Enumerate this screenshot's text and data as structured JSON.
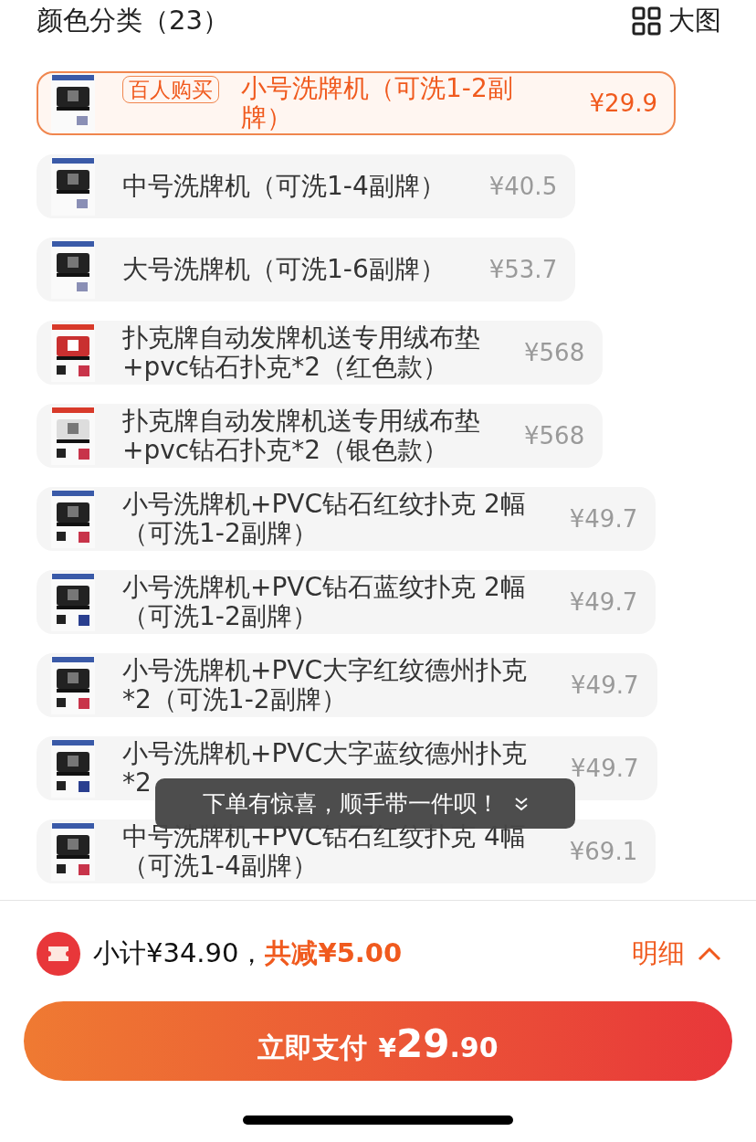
{
  "header": {
    "title": "颜色分类（23）",
    "view_toggle": "大图"
  },
  "options": [
    {
      "lines": [
        "小号洗牌机（可洗1-2副",
        "牌）"
      ],
      "price": "¥29.9",
      "selected": true,
      "badge": "百人购买"
    },
    {
      "lines": [
        "中号洗牌机（可洗1-4副牌）"
      ],
      "price": "¥40.5",
      "selected": false
    },
    {
      "lines": [
        "大号洗牌机（可洗1-6副牌）"
      ],
      "price": "¥53.7",
      "selected": false
    },
    {
      "lines": [
        "扑克牌自动发牌机送专用绒布垫",
        "+pvc钻石扑克*2（红色款）"
      ],
      "price": "¥568",
      "selected": false
    },
    {
      "lines": [
        "扑克牌自动发牌机送专用绒布垫",
        "+pvc钻石扑克*2（银色款）"
      ],
      "price": "¥568",
      "selected": false
    },
    {
      "lines": [
        "小号洗牌机+PVC钻石红纹扑克 2幅",
        "（可洗1-2副牌）"
      ],
      "price": "¥49.7",
      "selected": false
    },
    {
      "lines": [
        "小号洗牌机+PVC钻石蓝纹扑克 2幅",
        "（可洗1-2副牌）"
      ],
      "price": "¥49.7",
      "selected": false
    },
    {
      "lines": [
        "小号洗牌机+PVC大字红纹德州扑克",
        "*2（可洗1-2副牌）"
      ],
      "price": "¥49.7",
      "selected": false
    },
    {
      "lines": [
        "小号洗牌机+PVC大字蓝纹德州扑克",
        "*2"
      ],
      "price": "¥49.7",
      "selected": false
    },
    {
      "lines": [
        "中号洗牌机+PVC钻石红纹扑克 4幅",
        "（可洗1-4副牌）"
      ],
      "price": "¥69.1",
      "selected": false
    }
  ],
  "toast": {
    "text": "下单有惊喜，顺手带一件呗！"
  },
  "summary": {
    "subtotal": "小计¥34.90，",
    "discount": "共减¥5.00",
    "details": "明细"
  },
  "pay_button": {
    "label": "立即支付",
    "currency": "¥",
    "amount_int": "29",
    "amount_dec": ".90"
  }
}
